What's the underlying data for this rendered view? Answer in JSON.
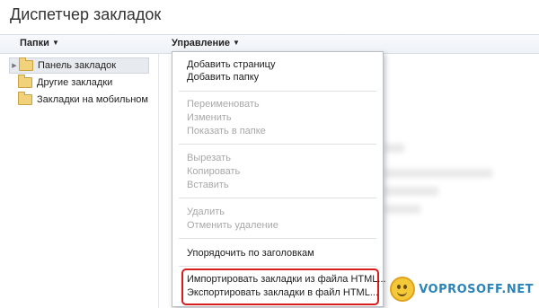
{
  "window": {
    "title": "Диспетчер закладок"
  },
  "header": {
    "folders_label": "Папки",
    "manage_label": "Управление"
  },
  "sidebar": {
    "items": [
      {
        "label": "Панель закладок",
        "selected": true,
        "expandable": true,
        "icon": "folder-icon"
      },
      {
        "label": "Другие закладки",
        "selected": false,
        "expandable": false,
        "icon": "folder-icon"
      },
      {
        "label": "Закладки на мобильном",
        "selected": false,
        "expandable": false,
        "icon": "folder-icon"
      }
    ]
  },
  "menu": {
    "groups": [
      [
        {
          "label": "Добавить страницу",
          "enabled": true
        },
        {
          "label": "Добавить папку",
          "enabled": true
        }
      ],
      [
        {
          "label": "Переименовать",
          "enabled": false
        },
        {
          "label": "Изменить",
          "enabled": false
        },
        {
          "label": "Показать в папке",
          "enabled": false
        }
      ],
      [
        {
          "label": "Вырезать",
          "enabled": false
        },
        {
          "label": "Копировать",
          "enabled": false
        },
        {
          "label": "Вставить",
          "enabled": false
        }
      ],
      [
        {
          "label": "Удалить",
          "enabled": false
        },
        {
          "label": "Отменить удаление",
          "enabled": false
        }
      ],
      [
        {
          "label": "Упорядочить по заголовкам",
          "enabled": true
        }
      ],
      [
        {
          "label": "Импортировать закладки из файла HTML...",
          "enabled": true,
          "highlighted": true
        },
        {
          "label": "Экспортировать закладки в файл HTML...",
          "enabled": true,
          "highlighted": true
        }
      ]
    ],
    "highlight_color": "#d81c1c"
  },
  "watermark": {
    "text": "VOPROSOFF.NET",
    "icon": "smiley-icon"
  }
}
